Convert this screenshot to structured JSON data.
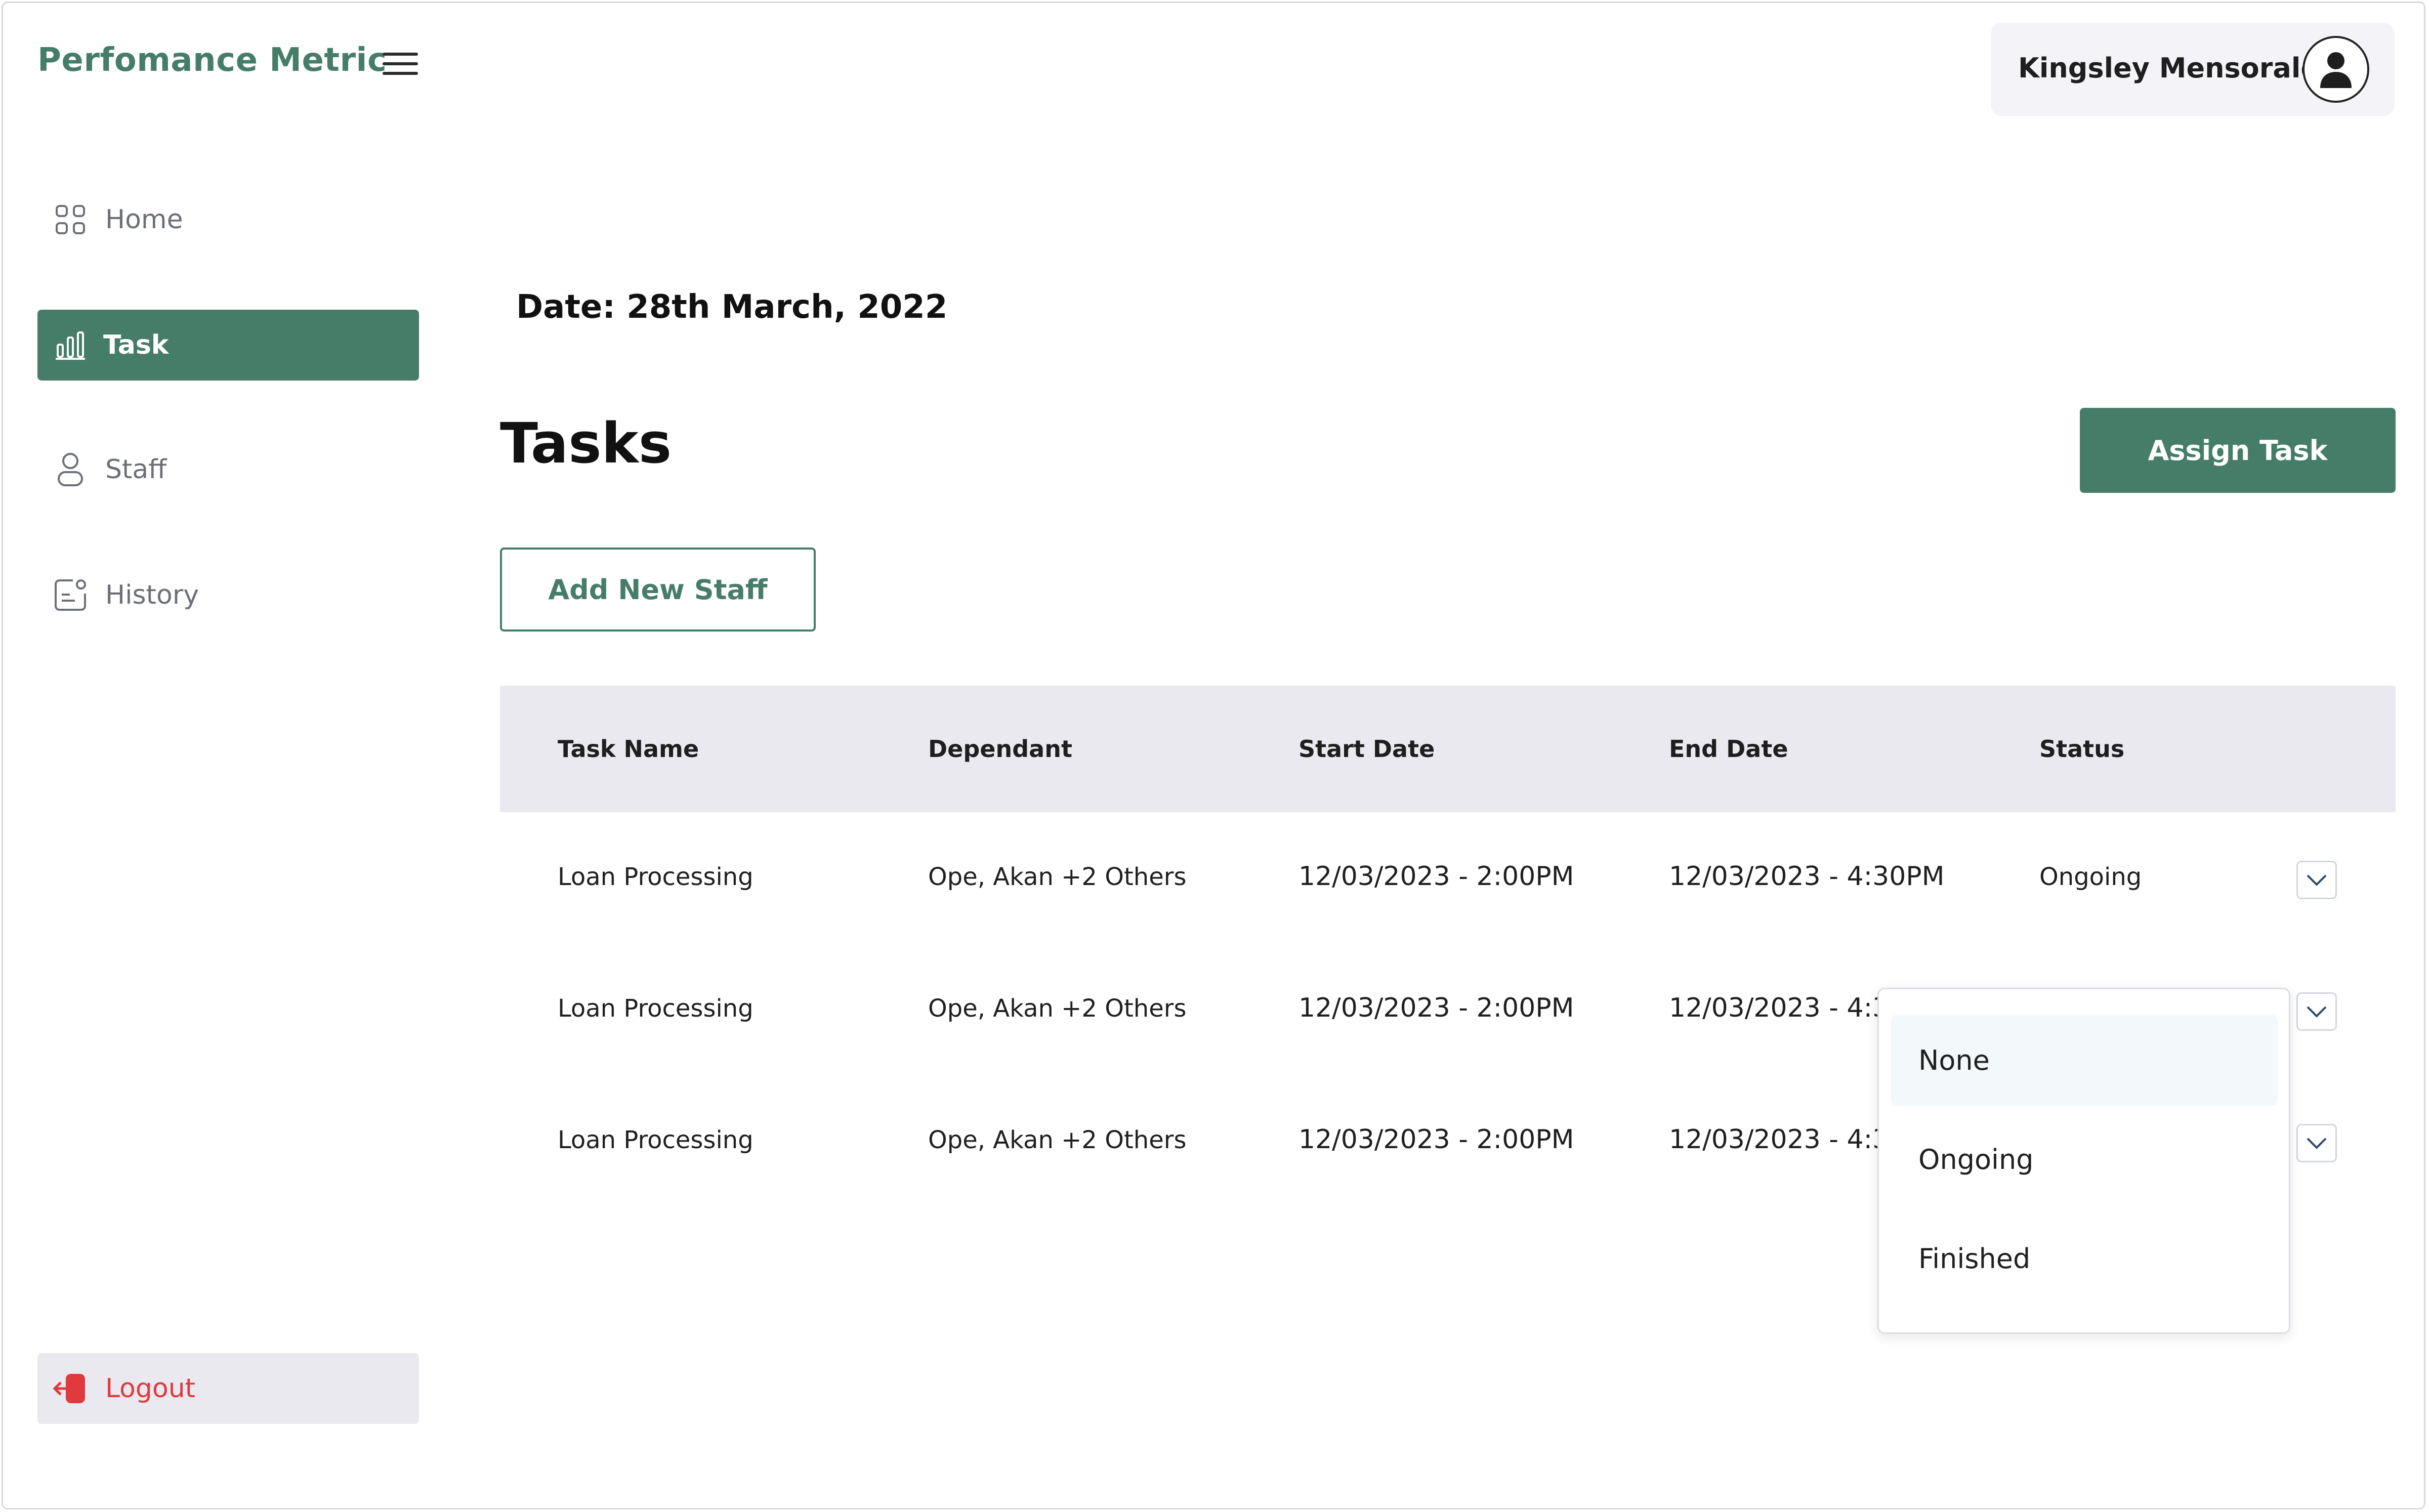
{
  "app": {
    "title": "Perfomance Metric"
  },
  "user": {
    "name": "Kingsley Mensorale"
  },
  "sidebar": {
    "items": [
      {
        "label": "Home",
        "icon": "grid-icon"
      },
      {
        "label": "Task",
        "icon": "bar-chart-icon",
        "active": true
      },
      {
        "label": "Staff",
        "icon": "user-icon"
      },
      {
        "label": "History",
        "icon": "history-icon"
      }
    ],
    "logout": {
      "label": "Logout",
      "icon": "logout-icon"
    }
  },
  "main": {
    "date": "Date: 28th March, 2022",
    "title": "Tasks",
    "assign_label": "Assign Task",
    "add_staff_label": "Add New Staff"
  },
  "table": {
    "headers": [
      "Task Name",
      "Dependant",
      "Start Date",
      "End Date",
      "Status"
    ],
    "rows": [
      {
        "task": "Loan Processing",
        "dependant": "Ope, Akan +2 Others",
        "start": "12/03/2023 - 2:00PM",
        "end": "12/03/2023 - 4:30PM",
        "status": "Ongoing"
      },
      {
        "task": "Loan Processing",
        "dependant": "Ope, Akan +2 Others",
        "start": "12/03/2023 - 2:00PM",
        "end": "12/03/2023 - 4:3",
        "status": ""
      },
      {
        "task": "Loan Processing",
        "dependant": "Ope, Akan +2 Others",
        "start": "12/03/2023 - 2:00PM",
        "end": "12/03/2023 - 4:3",
        "status": ""
      }
    ]
  },
  "status_dropdown": {
    "options": [
      "None",
      "Ongoing",
      "Finished"
    ],
    "highlighted": "None"
  },
  "colors": {
    "accent": "#467d69",
    "header_bg": "#e9e9ef",
    "logout_red": "#e0393e"
  }
}
